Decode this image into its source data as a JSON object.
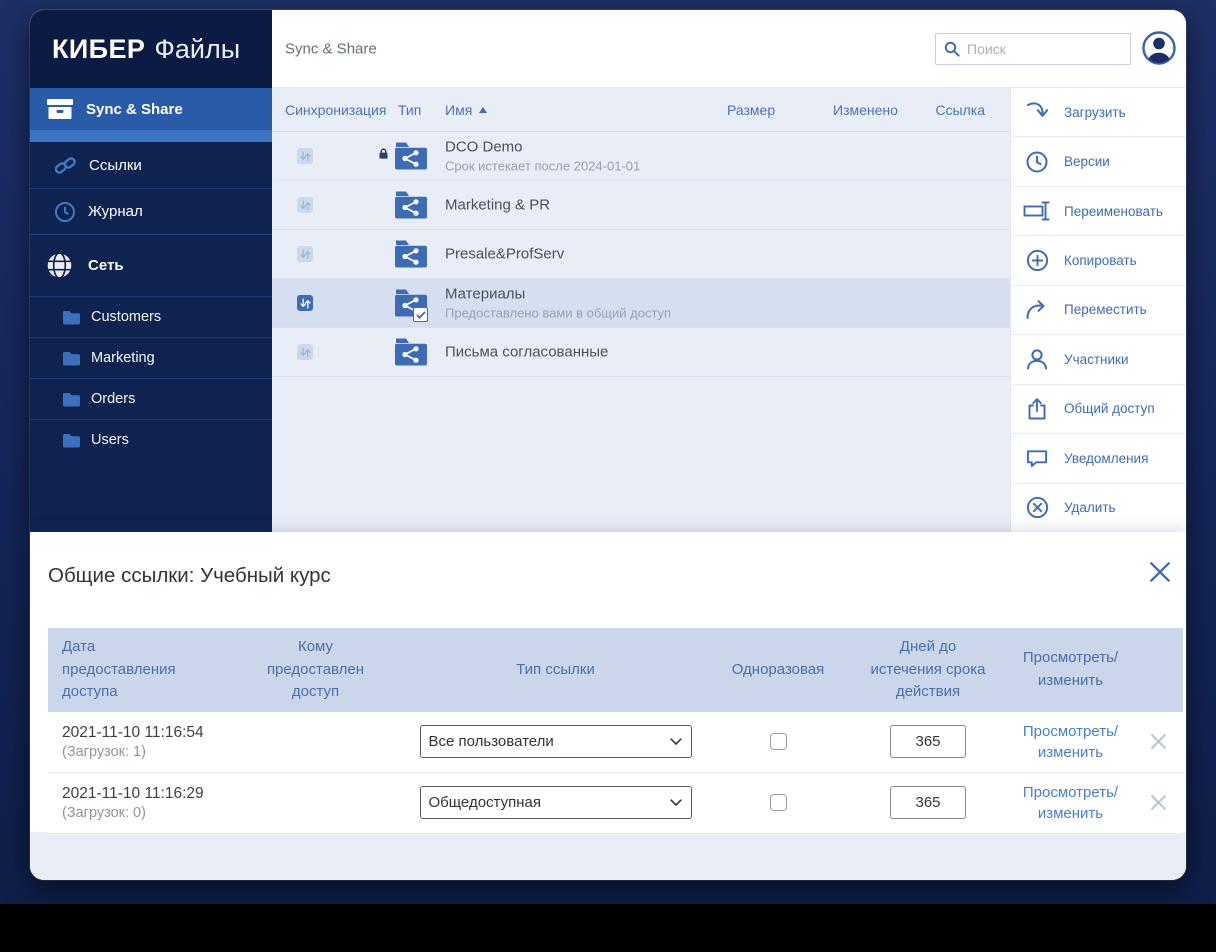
{
  "colors": {
    "accent": "#3e6cb4",
    "sidebar_bg": "#0f2350",
    "logo_bg": "#0b1b42",
    "active_item": "#2a5ba8",
    "selected_row": "#d5dff1",
    "list_bg": "#e9edf5",
    "modal_header_bg": "#ccd6ea"
  },
  "logo": {
    "brand_bold": "КИБЕР",
    "brand_light": "Файлы"
  },
  "topbar": {
    "title": "Sync & Share",
    "search_placeholder": "Поиск"
  },
  "sidebar": {
    "active_item": "Sync & Share",
    "items": [
      {
        "label": "Ссылки",
        "icon": "link-icon"
      },
      {
        "label": "Журнал",
        "icon": "clock-icon"
      }
    ],
    "network_section": "Сеть",
    "network_folders": [
      {
        "label": "Customers"
      },
      {
        "label": "Marketing"
      },
      {
        "label": "Orders"
      },
      {
        "label": "Users"
      }
    ]
  },
  "filetable": {
    "columns": {
      "sync": "Синхронизация",
      "type": "Тип",
      "name": "Имя",
      "size": "Размер",
      "modified": "Изменено",
      "link": "Ссылка"
    },
    "sort": {
      "column": "Имя",
      "direction": "asc"
    },
    "rows": [
      {
        "name": "DCO Demo",
        "subtitle": "Срок истекает после 2024-01-01",
        "locked": true,
        "selected": false,
        "checked": false
      },
      {
        "name": "Marketing & PR",
        "subtitle": "",
        "locked": false,
        "selected": false,
        "checked": false
      },
      {
        "name": "Presale&ProfServ",
        "subtitle": "",
        "locked": false,
        "selected": false,
        "checked": false
      },
      {
        "name": "Материалы",
        "subtitle": "Предоставлено вами в общий доступ",
        "locked": false,
        "selected": true,
        "checked": true
      },
      {
        "name": "Письма согласованные",
        "subtitle": "",
        "locked": false,
        "selected": false,
        "checked": false
      }
    ]
  },
  "actions": [
    {
      "label": "Загрузить",
      "icon": "download-icon"
    },
    {
      "label": "Версии",
      "icon": "versions-icon"
    },
    {
      "label": "Переименовать",
      "icon": "rename-icon"
    },
    {
      "label": "Копировать",
      "icon": "copy-icon"
    },
    {
      "label": "Переместить",
      "icon": "move-icon"
    },
    {
      "label": "Участники",
      "icon": "members-icon"
    },
    {
      "label": "Общий доступ",
      "icon": "share-icon"
    },
    {
      "label": "Уведомления",
      "icon": "notifications-icon"
    },
    {
      "label": "Удалить",
      "icon": "delete-icon"
    }
  ],
  "modal": {
    "title": "Общие ссылки: Учебный курс",
    "columns": [
      "Дата предоставления доступа",
      "Кому предоставлен доступ",
      "Тип ссылки",
      "Одноразовая",
      "Дней до истечения срока действия",
      "Просмотреть/изменить"
    ],
    "rows": [
      {
        "date": "2021-11-10 11:16:54",
        "downloads": "(Загрузок: 1)",
        "recipient": "",
        "link_type": "Все пользователи",
        "one_time": false,
        "days": "365",
        "action": "Просмотреть/изменить"
      },
      {
        "date": "2021-11-10 11:16:29",
        "downloads": "(Загрузок: 0)",
        "recipient": "",
        "link_type": "Общедоступная",
        "one_time": false,
        "days": "365",
        "action": "Просмотреть/изменить"
      }
    ]
  }
}
